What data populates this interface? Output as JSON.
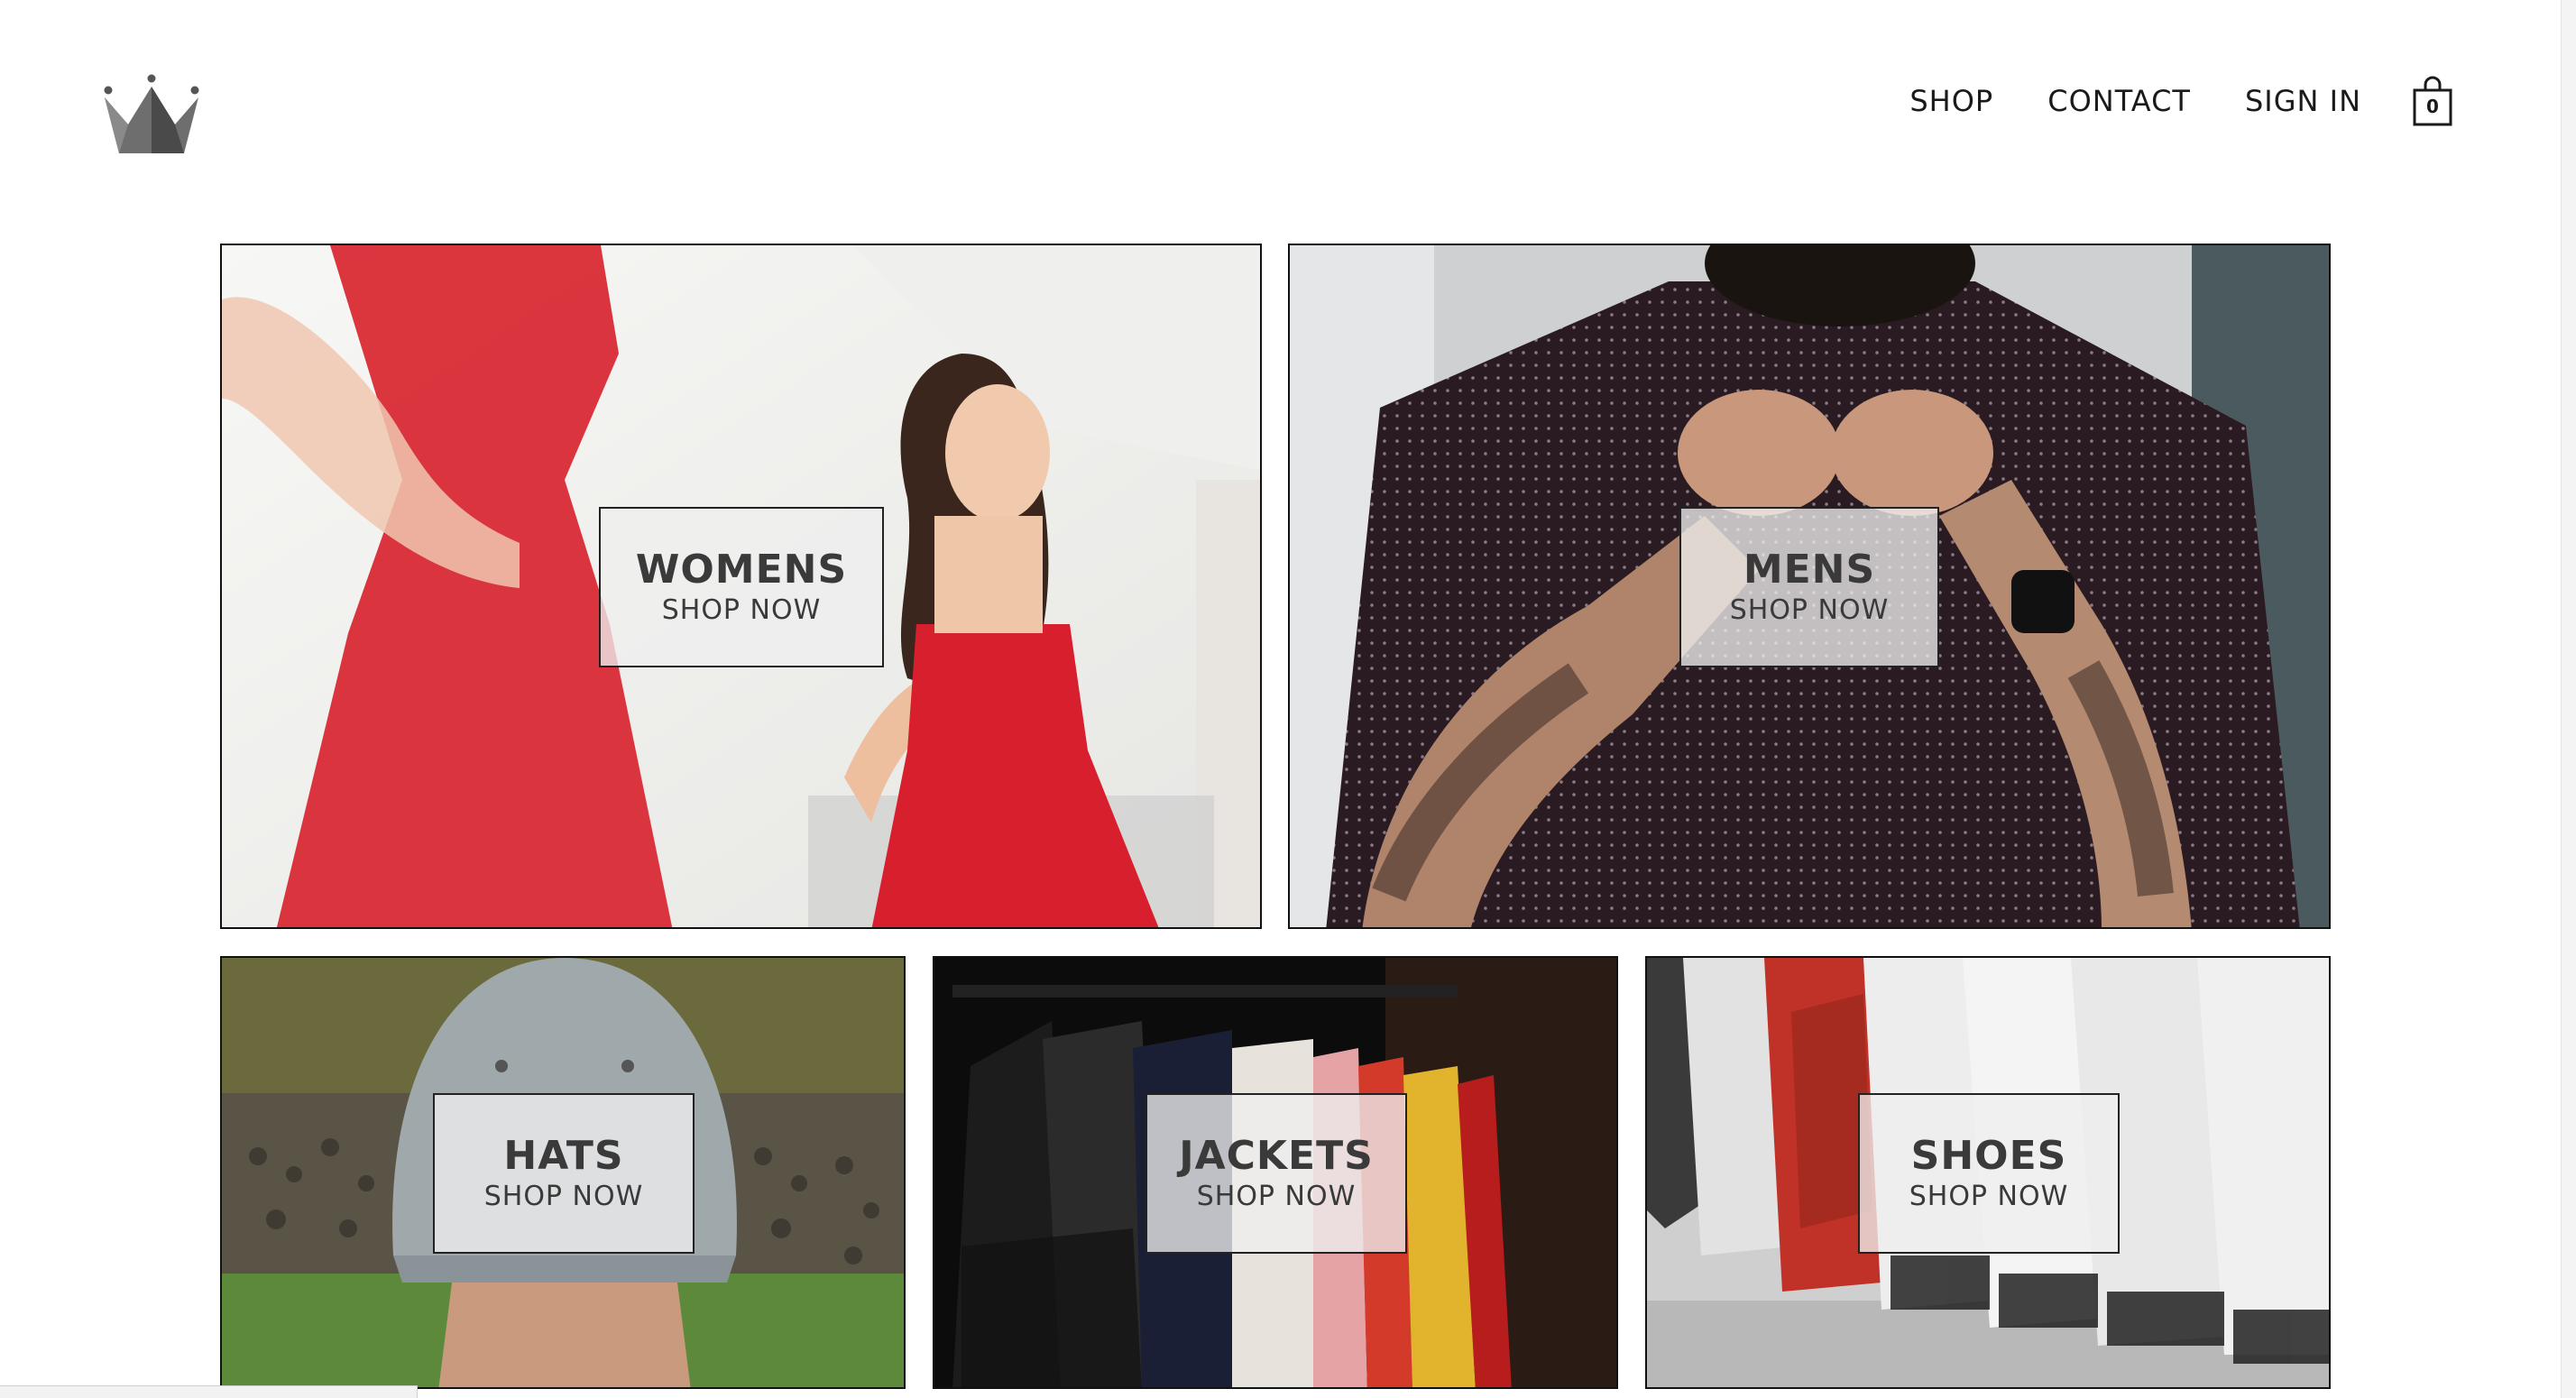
{
  "header": {
    "logo_icon": "crown-icon",
    "nav": [
      {
        "label": "SHOP"
      },
      {
        "label": "CONTACT"
      },
      {
        "label": "SIGN IN"
      }
    ],
    "cart": {
      "icon": "shopping-bag-icon",
      "count": "0"
    }
  },
  "categories": [
    {
      "title": "WOMENS",
      "cta": "SHOP NOW"
    },
    {
      "title": "MENS",
      "cta": "SHOP NOW"
    },
    {
      "title": "HATS",
      "cta": "SHOP NOW"
    },
    {
      "title": "JACKETS",
      "cta": "SHOP NOW"
    },
    {
      "title": "SHOES",
      "cta": "SHOP NOW"
    }
  ],
  "colors": {
    "text": "#1a1a1a",
    "label_bg": "#eeeeee",
    "border": "#111111"
  }
}
